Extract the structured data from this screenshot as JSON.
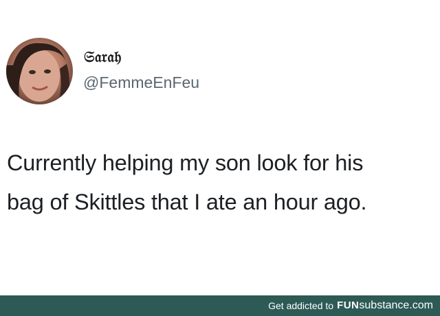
{
  "author": {
    "display_name": "𝔖𝔞𝔯𝔞𝔥",
    "handle": "@FemmeEnFeu"
  },
  "tweet": {
    "lines": [
      "Currently helping my son look for his",
      "bag of Skittles that I ate an hour ago."
    ]
  },
  "watermark": {
    "lead": "Get addicted to",
    "brand_bold": "FUN",
    "brand_rest": "substance.com"
  },
  "colors": {
    "footer_bg": "#2d5a55",
    "handle": "#5b6670",
    "text": "#1c1f23"
  }
}
